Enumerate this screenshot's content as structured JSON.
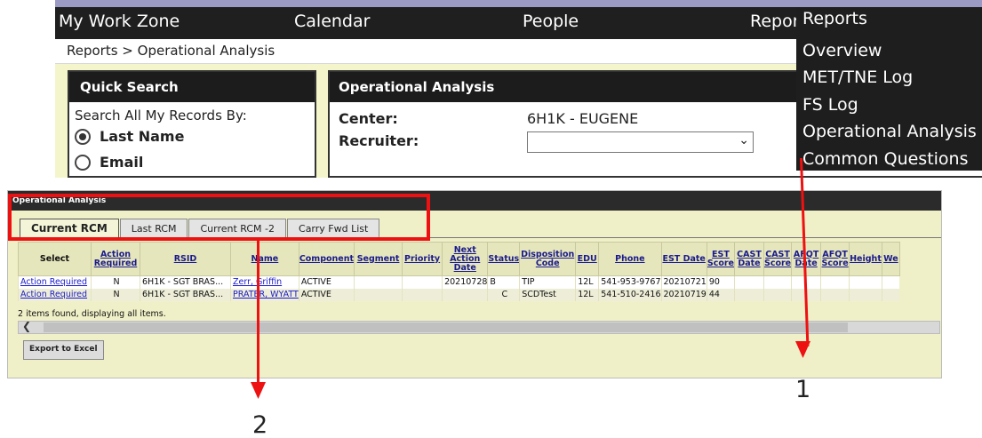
{
  "nav": {
    "items": [
      "My Work Zone",
      "Calendar",
      "People",
      "Reports"
    ]
  },
  "breadcrumb": "Reports > Operational Analysis",
  "quick_search": {
    "title": "Quick Search",
    "subtitle": "Search All My Records By:",
    "options": [
      {
        "label": "Last Name",
        "selected": true
      },
      {
        "label": "Email",
        "selected": false
      }
    ]
  },
  "operational_panel": {
    "title": "Operational Analysis",
    "center_label": "Center:",
    "center_value": "6H1K - EUGENE",
    "recruiter_label": "Recruiter:",
    "recruiter_value": ""
  },
  "reports_menu": {
    "items": [
      "Overview",
      "MET/TNE Log",
      "FS Log",
      "Operational Analysis",
      "Common Questions"
    ]
  },
  "grid": {
    "title": "Operational Analysis",
    "tabs": [
      {
        "label": "Current RCM",
        "active": true
      },
      {
        "label": "Last RCM",
        "active": false
      },
      {
        "label": "Current RCM -2",
        "active": false
      },
      {
        "label": "Carry Fwd List",
        "active": false
      }
    ],
    "columns": [
      "Select",
      "Action Required",
      "RSID",
      "Name",
      "Component",
      "Segment",
      "Priority",
      "Next Action Date",
      "Status",
      "Disposition Code",
      "EDU",
      "Phone",
      "EST Date",
      "EST Score",
      "CAST Date",
      "CAST Score",
      "AFQT Date",
      "AFQT Score",
      "Height",
      "We"
    ],
    "rows": [
      {
        "select": "Action Required",
        "action_required": "N",
        "rsid": "6H1K - SGT BRAS...",
        "name": "Zerr, Griffin",
        "component": "ACTIVE",
        "segment": "",
        "priority": "",
        "next_action_date": "20210728",
        "status": "B",
        "disposition_code": "TIP",
        "edu": "12L",
        "phone": "541-953-9767",
        "est_date": "20210721",
        "est_score": "90",
        "cast_date": "",
        "cast_score": "",
        "afqt_date": "",
        "afqt_score": "",
        "height": "",
        "we": ""
      },
      {
        "select": "Action Required",
        "action_required": "N",
        "rsid": "6H1K - SGT BRAS...",
        "name": "PRATER, WYATT",
        "component": "ACTIVE",
        "segment": "",
        "priority": "",
        "next_action_date": "",
        "status": "C",
        "disposition_code": "SCDTest",
        "edu": "12L",
        "phone": "541-510-2416",
        "est_date": "20210719",
        "est_score": "44",
        "cast_date": "",
        "cast_score": "",
        "afqt_date": "",
        "afqt_score": "",
        "height": "",
        "we": ""
      }
    ],
    "items_text": "2 items found, displaying all items.",
    "export_label": "Export to Excel"
  },
  "annotations": {
    "label_1": "1",
    "label_2": "2",
    "color": "#ee1111"
  },
  "icons": {
    "dropdown": "chevron-down-icon",
    "scroll_left": "scroll-left-icon"
  }
}
